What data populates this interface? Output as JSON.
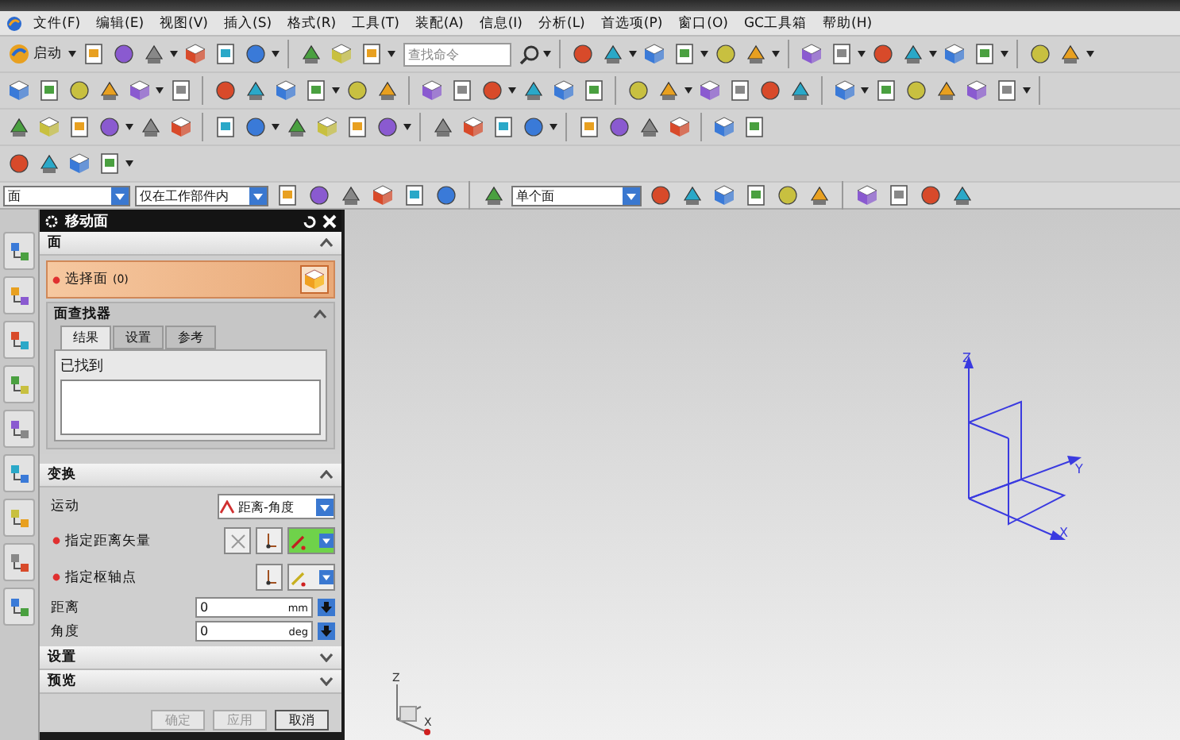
{
  "menu": [
    {
      "label": "文件(F)"
    },
    {
      "label": "编辑(E)"
    },
    {
      "label": "视图(V)"
    },
    {
      "label": "插入(S)"
    },
    {
      "label": "格式(R)"
    },
    {
      "label": "工具(T)"
    },
    {
      "label": "装配(A)"
    },
    {
      "label": "信息(I)"
    },
    {
      "label": "分析(L)"
    },
    {
      "label": "首选项(P)"
    },
    {
      "label": "窗口(O)"
    },
    {
      "label": "GC工具箱"
    },
    {
      "label": "帮助(H)"
    }
  ],
  "toolbar": {
    "start_label": "启动",
    "search": {
      "placeholder": "查找命令"
    }
  },
  "filter_bar": {
    "type_filter": "面",
    "scope_filter": "仅在工作部件内",
    "face_rule": "单个面"
  },
  "dialog": {
    "title": "移动面",
    "face_section": {
      "title": "面",
      "expanded": true,
      "select_face": {
        "label": "选择面",
        "count": "(0)",
        "required": true
      },
      "finder": {
        "title": "面查找器",
        "expanded": true,
        "tabs": [
          {
            "label": "结果",
            "selected": true
          },
          {
            "label": "设置",
            "selected": false
          },
          {
            "label": "参考",
            "selected": false
          }
        ],
        "found_label": "已找到"
      }
    },
    "transform_section": {
      "title": "变换",
      "expanded": true,
      "motion": {
        "label": "运动",
        "value": "距离-角度"
      },
      "vector": {
        "label": "指定距离矢量",
        "required": true
      },
      "pivot": {
        "label": "指定枢轴点",
        "required": true
      },
      "fields": [
        {
          "label": "距离",
          "value": "0",
          "unit": "mm"
        },
        {
          "label": "角度",
          "value": "0",
          "unit": "deg"
        }
      ]
    },
    "collapsed_sections": [
      {
        "title": "设置",
        "expanded": false
      },
      {
        "title": "预览",
        "expanded": false
      }
    ],
    "buttons": [
      {
        "label": "确定",
        "disabled": true
      },
      {
        "label": "应用",
        "disabled": true
      },
      {
        "label": "取消",
        "disabled": false
      }
    ]
  },
  "viewport": {
    "triad": {
      "z": "Z",
      "y": "Y",
      "x": "X"
    },
    "mini_triad": {
      "z": "Z",
      "x": "X"
    }
  }
}
